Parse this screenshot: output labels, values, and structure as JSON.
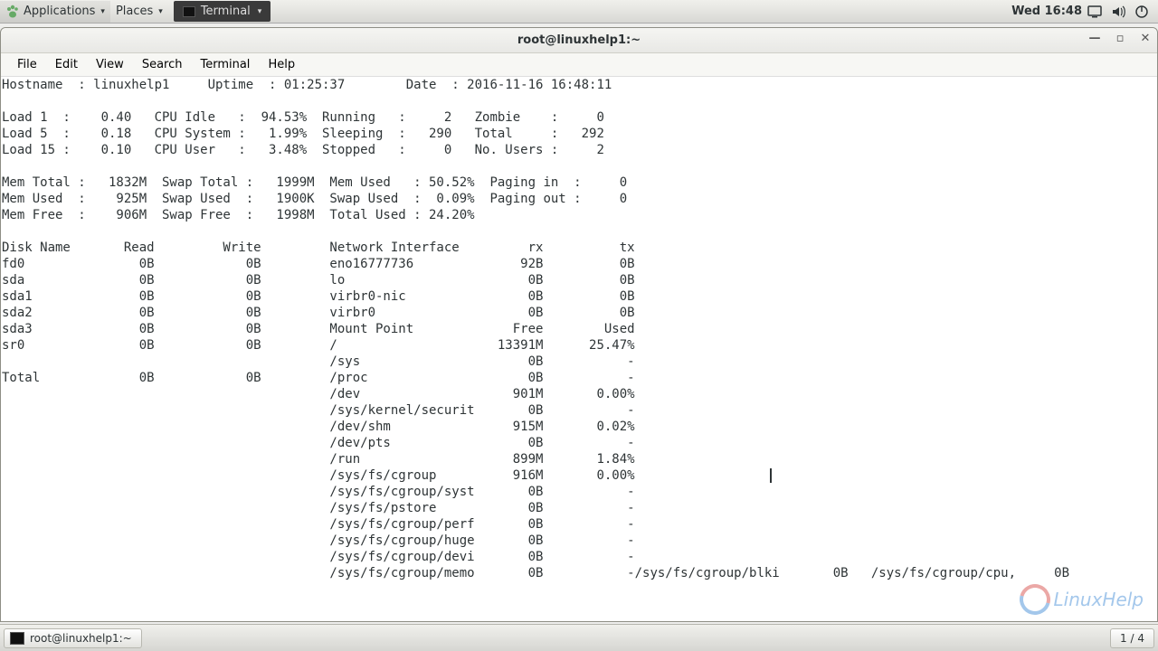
{
  "top_bar": {
    "applications": "Applications",
    "places": "Places",
    "terminal_tab": "Terminal",
    "clock": "Wed 16:48"
  },
  "window": {
    "title": "root@linuxhelp1:~",
    "menu": {
      "file": "File",
      "edit": "Edit",
      "view": "View",
      "search": "Search",
      "terminal": "Terminal",
      "help": "Help"
    }
  },
  "overview": {
    "hostname_label": "Hostname",
    "hostname": "linuxhelp1",
    "uptime_label": "Uptime",
    "uptime": "01:25:37",
    "date_label": "Date",
    "date": "2016-11-16 16:48:11",
    "load1_label": "Load 1",
    "load1": "0.40",
    "load5_label": "Load 5",
    "load5": "0.18",
    "load15_label": "Load 15",
    "load15": "0.10",
    "cpu_idle_label": "CPU Idle",
    "cpu_idle": "94.53%",
    "cpu_system_label": "CPU System",
    "cpu_system": "1.99%",
    "cpu_user_label": "CPU User",
    "cpu_user": "3.48%",
    "running_label": "Running",
    "running": "2",
    "sleeping_label": "Sleeping",
    "sleeping": "290",
    "stopped_label": "Stopped",
    "stopped": "0",
    "zombie_label": "Zombie",
    "zombie": "0",
    "total_label": "Total",
    "total": "292",
    "users_label": "No. Users",
    "users": "2",
    "mem_total_label": "Mem Total",
    "mem_total": "1832M",
    "mem_used_label": "Mem Used",
    "mem_used": "925M",
    "mem_free_label": "Mem Free",
    "mem_free": "906M",
    "swap_total_label": "Swap Total",
    "swap_total": "1999M",
    "swap_used_label": "Swap Used",
    "swap_used": "1900K",
    "swap_free_label": "Swap Free",
    "swap_free": "1998M",
    "mem_used_pct_label": "Mem Used",
    "mem_used_pct": "50.52%",
    "swap_used_pct_label": "Swap Used",
    "swap_used_pct": "0.09%",
    "total_used_label": "Total Used",
    "total_used": "24.20%",
    "paging_in_label": "Paging in",
    "paging_in": "0",
    "paging_out_label": "Paging out",
    "paging_out": "0"
  },
  "disk": {
    "header_name": "Disk Name",
    "header_read": "Read",
    "header_write": "Write",
    "rows": [
      {
        "name": "fd0",
        "read": "0B",
        "write": "0B"
      },
      {
        "name": "sda",
        "read": "0B",
        "write": "0B"
      },
      {
        "name": "sda1",
        "read": "0B",
        "write": "0B"
      },
      {
        "name": "sda2",
        "read": "0B",
        "write": "0B"
      },
      {
        "name": "sda3",
        "read": "0B",
        "write": "0B"
      },
      {
        "name": "sr0",
        "read": "0B",
        "write": "0B"
      }
    ],
    "total_label": "Total",
    "total_read": "0B",
    "total_write": "0B"
  },
  "net": {
    "header_iface": "Network Interface",
    "header_rx": "rx",
    "header_tx": "tx",
    "rows": [
      {
        "iface": "eno16777736",
        "rx": "92B",
        "tx": "0B"
      },
      {
        "iface": "lo",
        "rx": "0B",
        "tx": "0B"
      },
      {
        "iface": "virbr0-nic",
        "rx": "0B",
        "tx": "0B"
      },
      {
        "iface": "virbr0",
        "rx": "0B",
        "tx": "0B"
      }
    ]
  },
  "mount": {
    "header_point": "Mount Point",
    "header_free": "Free",
    "header_used": "Used",
    "rows": [
      {
        "point": "/",
        "free": "13391M",
        "used": "25.47%"
      },
      {
        "point": "/sys",
        "free": "0B",
        "used": "-"
      },
      {
        "point": "/proc",
        "free": "0B",
        "used": "-"
      },
      {
        "point": "/dev",
        "free": "901M",
        "used": "0.00%"
      },
      {
        "point": "/sys/kernel/securit",
        "free": "0B",
        "used": "-"
      },
      {
        "point": "/dev/shm",
        "free": "915M",
        "used": "0.02%"
      },
      {
        "point": "/dev/pts",
        "free": "0B",
        "used": "-"
      },
      {
        "point": "/run",
        "free": "899M",
        "used": "1.84%"
      },
      {
        "point": "/sys/fs/cgroup",
        "free": "916M",
        "used": "0.00%"
      },
      {
        "point": "/sys/fs/cgroup/syst",
        "free": "0B",
        "used": "-"
      },
      {
        "point": "/sys/fs/pstore",
        "free": "0B",
        "used": "-"
      },
      {
        "point": "/sys/fs/cgroup/perf",
        "free": "0B",
        "used": "-"
      },
      {
        "point": "/sys/fs/cgroup/huge",
        "free": "0B",
        "used": "-"
      },
      {
        "point": "/sys/fs/cgroup/devi",
        "free": "0B",
        "used": "-"
      }
    ],
    "extra": {
      "point1": "/sys/fs/cgroup/memo",
      "free1": "0B",
      "used1": "-",
      "point2": "/sys/fs/cgroup/blki",
      "free2": "0B",
      "point3": "/sys/fs/cgroup/cpu,",
      "free3": "0B"
    }
  },
  "taskbar": {
    "task_title": "root@linuxhelp1:~",
    "page": "1 / 4"
  },
  "logo_text": "LinuxHelp"
}
